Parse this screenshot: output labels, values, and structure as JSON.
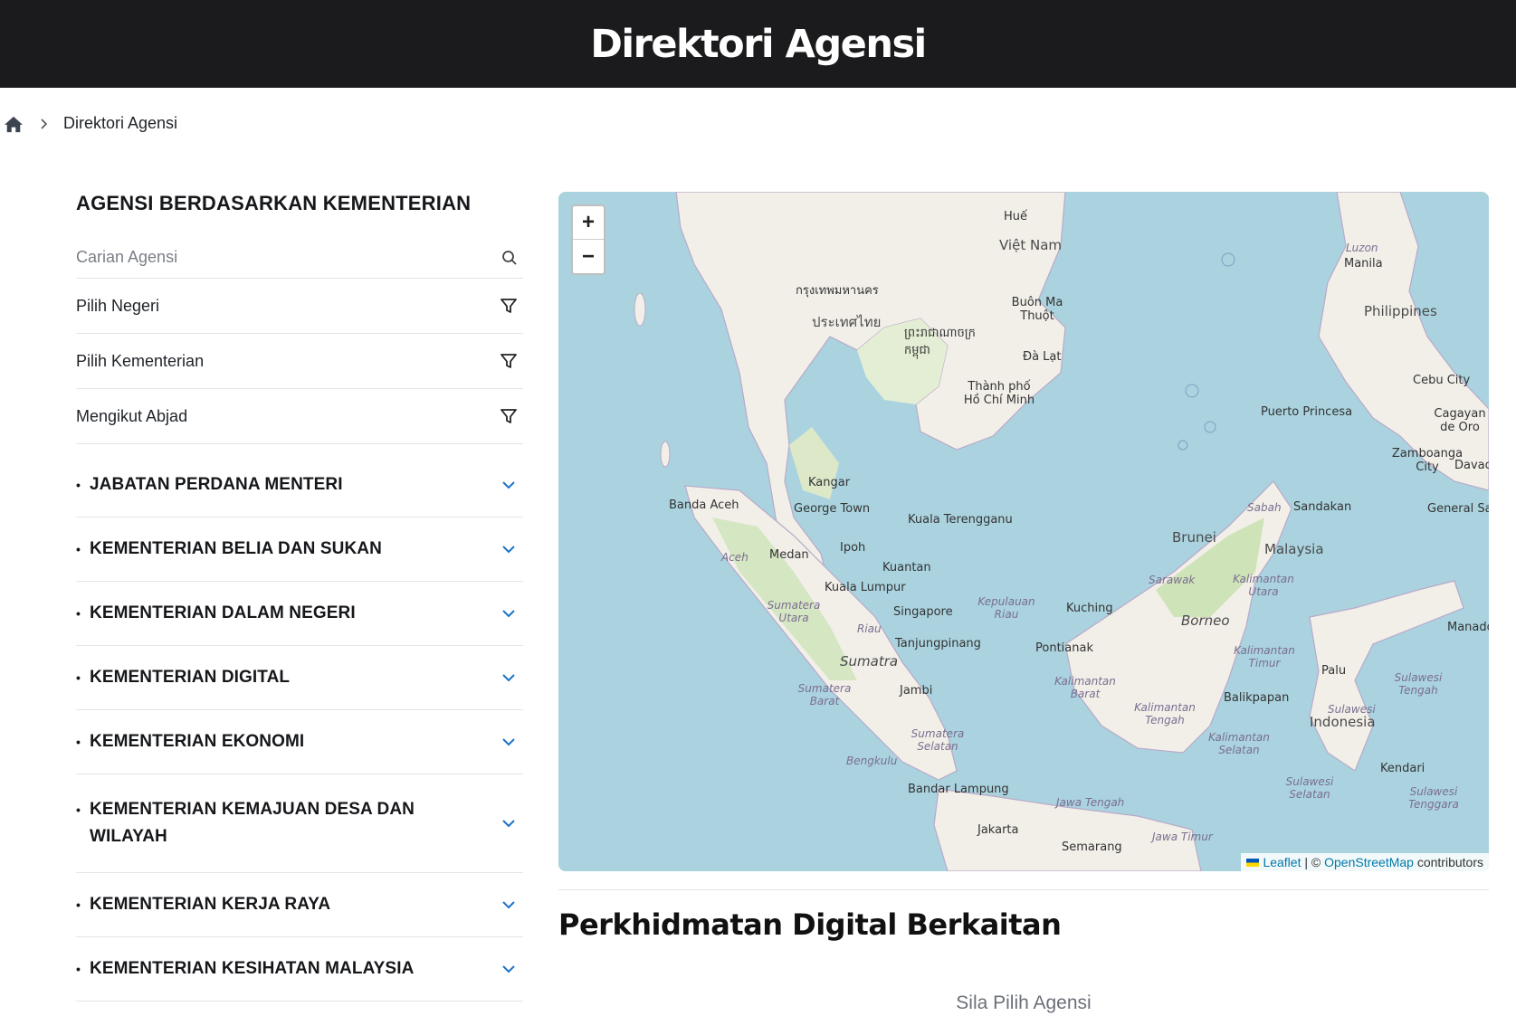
{
  "header": {
    "title": "Direktori Agensi"
  },
  "breadcrumb": {
    "home_icon": "home-icon",
    "current": "Direktori Agensi"
  },
  "sidebar": {
    "heading": "AGENSI BERDASARKAN KEMENTERIAN",
    "search": {
      "placeholder": "Carian Agensi",
      "value": ""
    },
    "filters": [
      {
        "label": "Pilih Negeri"
      },
      {
        "label": "Pilih Kementerian"
      },
      {
        "label": "Mengikut Abjad"
      }
    ],
    "ministries": [
      {
        "label": "JABATAN PERDANA MENTERI"
      },
      {
        "label": "KEMENTERIAN BELIA DAN SUKAN"
      },
      {
        "label": "KEMENTERIAN DALAM NEGERI"
      },
      {
        "label": "KEMENTERIAN DIGITAL"
      },
      {
        "label": "KEMENTERIAN EKONOMI"
      },
      {
        "label": "KEMENTERIAN KEMAJUAN DESA DAN WILAYAH"
      },
      {
        "label": "KEMENTERIAN KERJA RAYA"
      },
      {
        "label": "KEMENTERIAN KESIHATAN MALAYSIA"
      }
    ]
  },
  "map": {
    "zoom_in": "+",
    "zoom_out": "−",
    "attribution": {
      "leaflet": "Leaflet",
      "sep": " | © ",
      "osm": "OpenStreetMap",
      "suffix": " contributors"
    },
    "labels": {
      "hue": "Huế",
      "vietnam": "Việt Nam",
      "bangkok": "กรุงเทพมหานคร",
      "thailand": "ประเทศไทย",
      "cambodia": "ព្រះរាជាណាចក្រ កម្ពុជា",
      "buonmathuot": "Buôn Ma Thuột",
      "dalat": "Đà Lạt",
      "hcm": "Thành phố Hồ Chí Minh",
      "luzon": "Luzon",
      "manila": "Manila",
      "philippines": "Philippines",
      "cebu": "Cebu City",
      "puerto": "Puerto Princesa",
      "cagayan": "Cagayan de Oro",
      "zamboanga": "Zamboanga City",
      "davao": "Davao",
      "gensan": "General Sa",
      "kangar": "Kangar",
      "bandaaceh": "Banda Aceh",
      "georgetown": "George Town",
      "kualaterengganu": "Kuala Terengganu",
      "ipoh": "Ipoh",
      "medan": "Medan",
      "kuantan": "Kuantan",
      "kualalumpur": "Kuala Lumpur",
      "singapore": "Singapore",
      "tanjung": "Tanjungpinang",
      "sumatra": "Sumatra",
      "jambi": "Jambi",
      "bengkulu": "Bengkulu",
      "bandarlampung": "Bandar Lampung",
      "jakarta": "Jakarta",
      "semarang": "Semarang",
      "kuching": "Kuching",
      "pontianak": "Pontianak",
      "brunei": "Brunei",
      "malaysia": "Malaysia",
      "sandakan": "Sandakan",
      "sabah": "Sabah",
      "sarawak": "Sarawak",
      "borneo": "Borneo",
      "balikpapan": "Balikpapan",
      "palu": "Palu",
      "indonesia": "Indonesia",
      "manado": "Manado",
      "kendari": "Kendari",
      "aceh": "Aceh",
      "sumut": "Sumatera Utara",
      "riau": "Riau",
      "kepriau": "Kepulauan Riau",
      "sumbar": "Sumatera Barat",
      "sumsel": "Sumatera Selatan",
      "jateng": "Jawa Tengah",
      "jatim": "Jawa Timur",
      "kalbar": "Kalimantan Barat",
      "kalteng": "Kalimantan Tengah",
      "kalsel": "Kalimantan Selatan",
      "kaltim": "Kalimantan Timur",
      "kalut": "Kalimantan Utara",
      "sulteng": "Sulawesi Tengah",
      "sulsel": "Sulawesi Selatan",
      "sultra": "Sulawesi Tenggara",
      "sulbar": "Sulawesi"
    }
  },
  "related": {
    "title": "Perkhidmatan Digital Berkaitan",
    "empty": "Sila Pilih Agensi"
  }
}
